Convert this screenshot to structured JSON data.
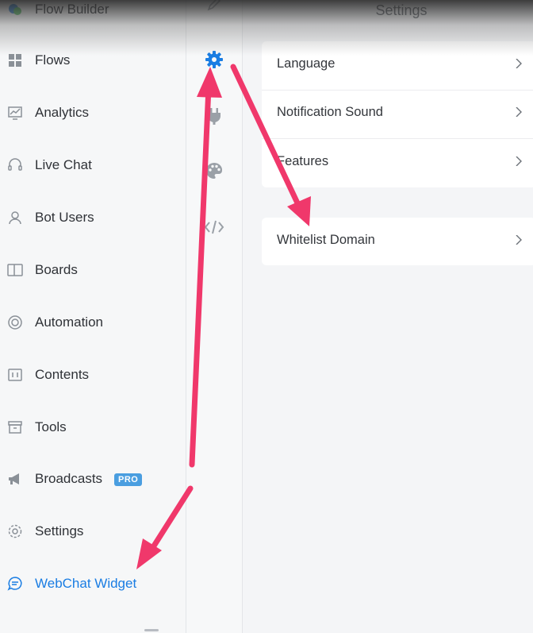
{
  "sidebar": {
    "items": [
      {
        "label": "Flow Builder",
        "icon": "chat-bubbles-icon"
      },
      {
        "label": "Flows",
        "icon": "grid-icon"
      },
      {
        "label": "Analytics",
        "icon": "chart-icon"
      },
      {
        "label": "Live Chat",
        "icon": "headset-icon"
      },
      {
        "label": "Bot Users",
        "icon": "user-icon"
      },
      {
        "label": "Boards",
        "icon": "board-icon"
      },
      {
        "label": "Automation",
        "icon": "lifebuoy-icon"
      },
      {
        "label": "Contents",
        "icon": "contents-icon"
      },
      {
        "label": "Tools",
        "icon": "archive-icon"
      },
      {
        "label": "Broadcasts",
        "icon": "megaphone-icon",
        "badge": "PRO"
      },
      {
        "label": "Settings",
        "icon": "gear-icon"
      },
      {
        "label": "WebChat Widget",
        "icon": "chat-icon",
        "active": true
      }
    ]
  },
  "mid_icons": [
    "pencil-icon",
    "gear-icon",
    "plug-icon",
    "palette-icon",
    "code-icon"
  ],
  "main": {
    "title": "Settings",
    "group1": [
      "Language",
      "Notification Sound",
      "Features"
    ],
    "group2": [
      "Whitelist Domain"
    ]
  },
  "colors": {
    "accent": "#1a7de3",
    "annotation_arrow": "#f0386b",
    "pro_badge": "#4a9ee0"
  }
}
